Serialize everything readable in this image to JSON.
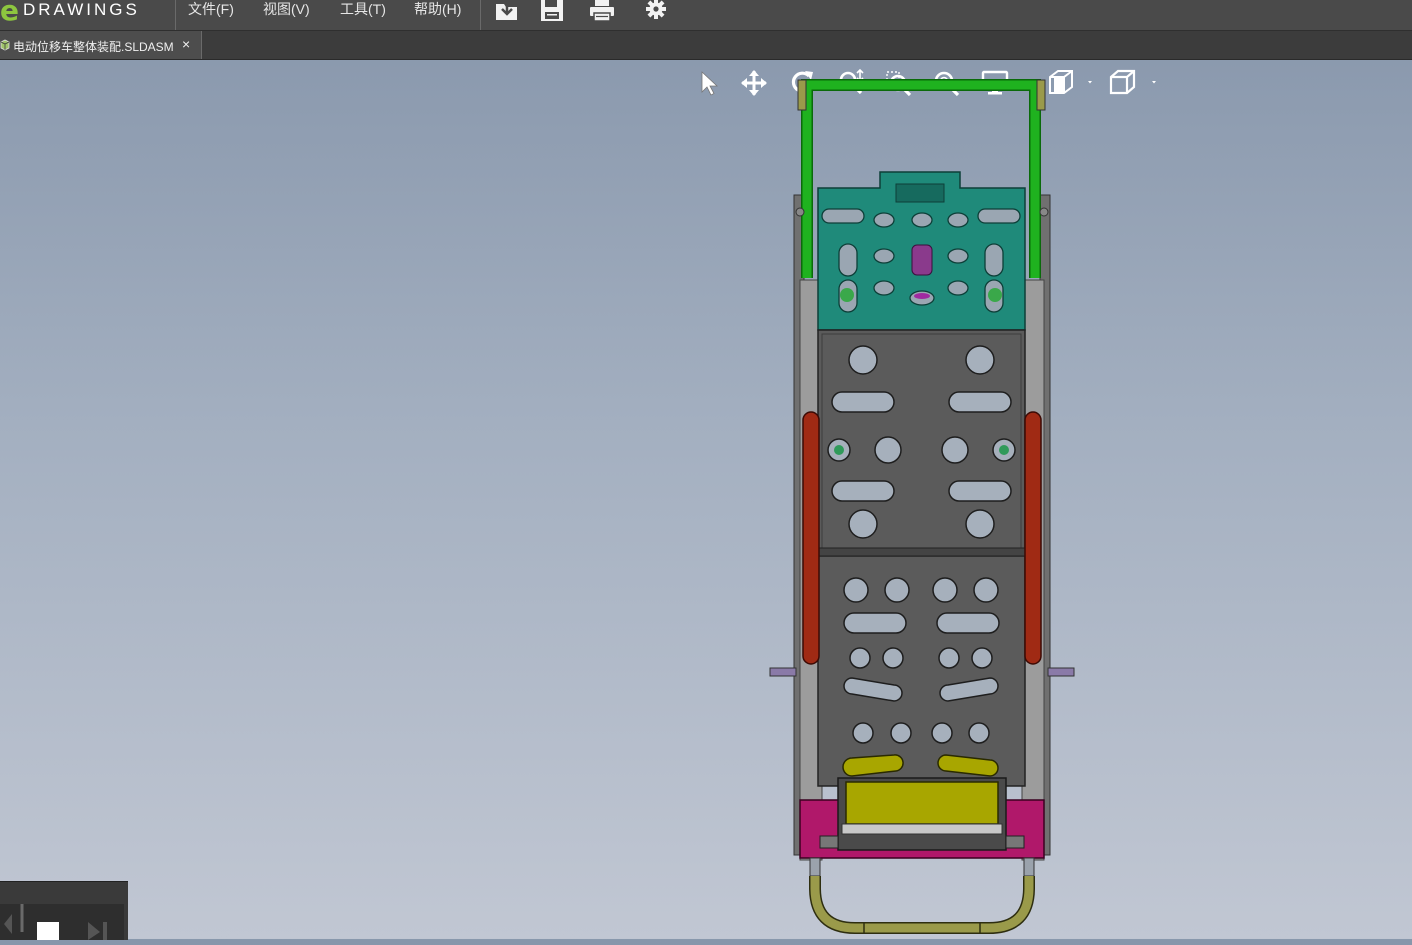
{
  "app": {
    "logo_text": "DRAWINGS",
    "logo_mark": "e"
  },
  "menu": {
    "file": "文件(F)",
    "view": "视图(V)",
    "tools": "工具(T)",
    "help": "帮助(H)"
  },
  "toolbar": {
    "icons": [
      "open-icon",
      "save-icon",
      "print-icon",
      "settings-gear-icon"
    ]
  },
  "document_tab": {
    "title": "电动位移车整体装配.SLDASM",
    "close": "×"
  },
  "view_toolbar": {
    "icons": [
      "select-arrow-icon",
      "pan-icon",
      "rotate-icon",
      "zoom-fit-icon",
      "zoom-area-icon",
      "zoom-icon",
      "display-style-icon",
      "section-view-icon",
      "view-orientation-cube-icon"
    ]
  },
  "colors": {
    "menubar_bg": "#4a4a4a",
    "tabbar_bg": "#3c3c3c",
    "viewport_top": "#8796ab",
    "viewport_bottom": "#c1c7d3",
    "handle_green": "#1fa81f",
    "upper_plate_teal": "#1f8a7a",
    "main_plate_gray": "#5b5b5b",
    "side_rail_red": "#a02a14",
    "yellow_parts": "#a8a600",
    "magenta_bracket": "#b0186a",
    "bottom_handle_olive": "#9a9a4a",
    "logo_green": "#8dc63f"
  }
}
